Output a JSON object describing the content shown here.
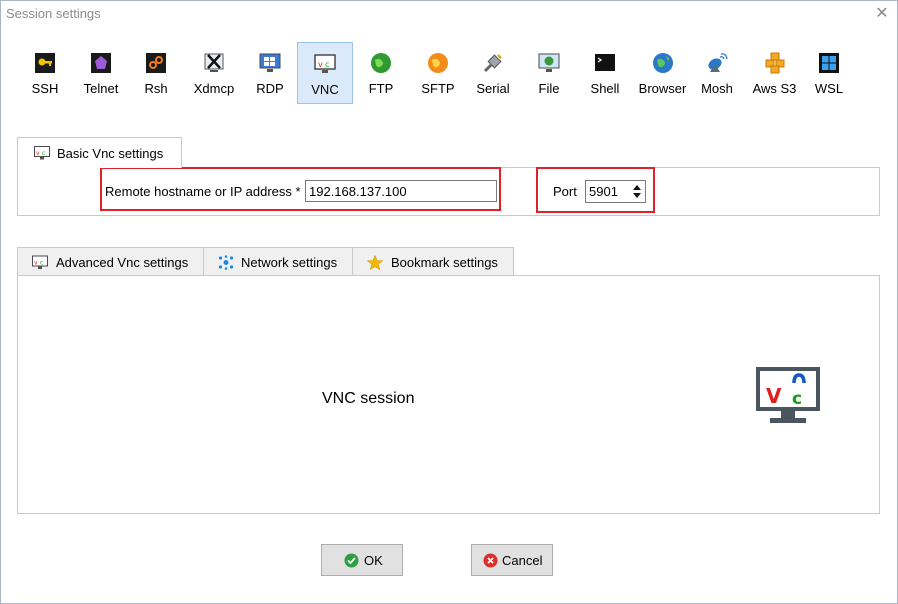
{
  "window": {
    "title": "Session settings"
  },
  "protocols": [
    {
      "label": "SSH",
      "icon": "key-icon"
    },
    {
      "label": "Telnet",
      "icon": "telnet-icon"
    },
    {
      "label": "Rsh",
      "icon": "rsh-icon"
    },
    {
      "label": "Xdmcp",
      "icon": "x-icon"
    },
    {
      "label": "RDP",
      "icon": "rdp-monitor-icon"
    },
    {
      "label": "VNC",
      "icon": "vnc-icon",
      "selected": true
    },
    {
      "label": "FTP",
      "icon": "ftp-globe-icon"
    },
    {
      "label": "SFTP",
      "icon": "sftp-icon"
    },
    {
      "label": "Serial",
      "icon": "serial-plug-icon"
    },
    {
      "label": "File",
      "icon": "file-monitor-icon"
    },
    {
      "label": "Shell",
      "icon": "shell-terminal-icon"
    },
    {
      "label": "Browser",
      "icon": "browser-globe-icon"
    },
    {
      "label": "Mosh",
      "icon": "mosh-antenna-icon"
    },
    {
      "label": "Aws S3",
      "icon": "aws-cubes-icon"
    },
    {
      "label": "WSL",
      "icon": "windows-icon"
    }
  ],
  "basic": {
    "tab_label": "Basic Vnc settings",
    "host_label": "Remote hostname or IP address *",
    "host_value": "192.168.137.100",
    "port_label": "Port",
    "port_value": "5901"
  },
  "tabs": [
    {
      "label": "Advanced Vnc settings",
      "icon": "vnc-icon"
    },
    {
      "label": "Network settings",
      "icon": "network-icon"
    },
    {
      "label": "Bookmark settings",
      "icon": "star-icon"
    }
  ],
  "main": {
    "text": "VNC session"
  },
  "buttons": {
    "ok_label": "OK",
    "cancel_label": "Cancel"
  },
  "colors": {
    "highlight": "#e0202a",
    "selected_bg": "#dbeafa",
    "ok_green": "#2ea043",
    "cancel_red": "#d9302c"
  }
}
